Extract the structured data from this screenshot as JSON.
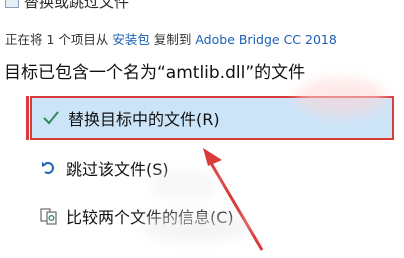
{
  "dialog": {
    "title": "替换或跳过文件",
    "copy_status": {
      "prefix": "正在将 1 个项目从 ",
      "source": "安装包",
      "middle": " 复制到 ",
      "destination": "Adobe Bridge CC 2018"
    },
    "conflict_message": "目标已包含一个名为“amtlib.dll”的文件",
    "options": [
      {
        "label": "替换目标中的文件(R)",
        "icon": "check-icon",
        "selected": true
      },
      {
        "label": "跳过该文件(S)",
        "icon": "skip-arrow-icon",
        "selected": false
      },
      {
        "label": "比较两个文件的信息(C)",
        "icon": "compare-files-icon",
        "selected": false
      }
    ]
  },
  "colors": {
    "selection_fill": "#cce4f7",
    "annotation_red": "#d93a3a",
    "link_blue": "#1a5fb4",
    "check_green": "#2e8b57"
  }
}
